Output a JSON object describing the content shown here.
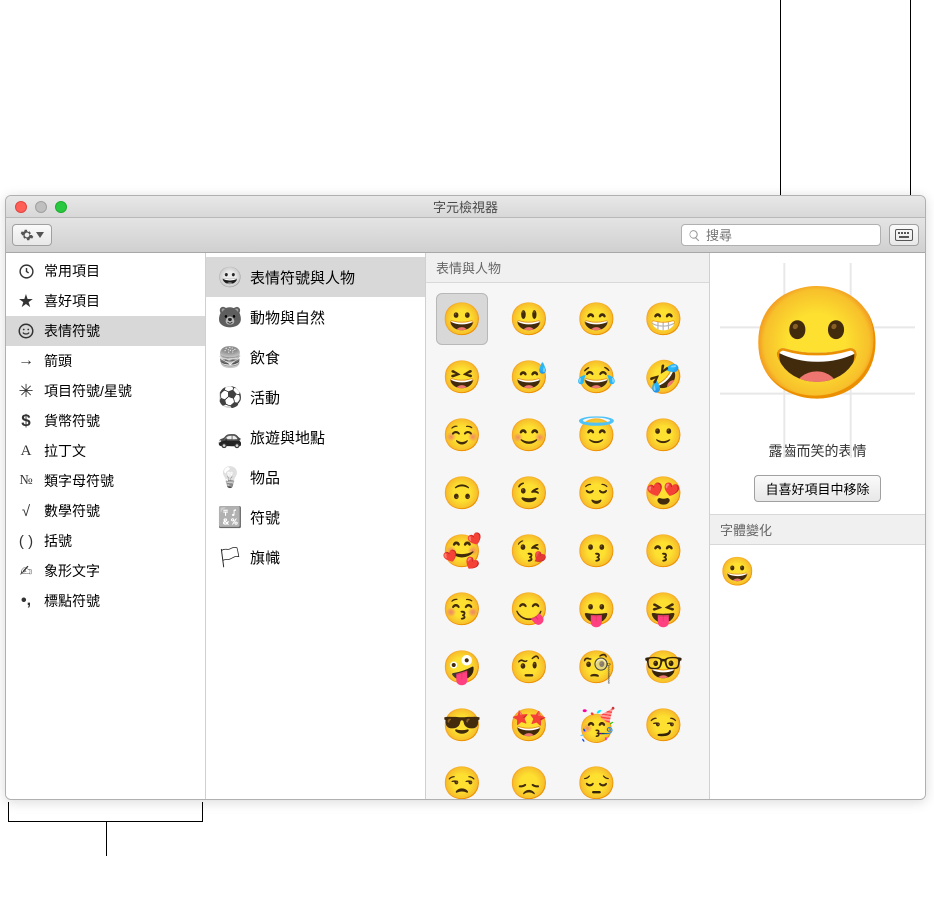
{
  "window": {
    "title": "字元檢視器",
    "search_placeholder": "搜尋"
  },
  "sidebar1": {
    "items": [
      {
        "icon": "clock",
        "label": "常用項目"
      },
      {
        "icon": "star",
        "label": "喜好項目"
      },
      {
        "icon": "smiley",
        "label": "表情符號",
        "selected": true
      },
      {
        "icon": "arrow",
        "label": "箭頭"
      },
      {
        "icon": "asterisk",
        "label": "項目符號/星號"
      },
      {
        "icon": "dollar",
        "label": "貨幣符號"
      },
      {
        "icon": "latin",
        "label": "拉丁文"
      },
      {
        "icon": "letterlike",
        "label": "類字母符號"
      },
      {
        "icon": "math",
        "label": "數學符號"
      },
      {
        "icon": "paren",
        "label": "括號"
      },
      {
        "icon": "picto",
        "label": "象形文字"
      },
      {
        "icon": "punct",
        "label": "標點符號"
      }
    ]
  },
  "sidebar2": {
    "items": [
      {
        "emoji": "😀",
        "label": "表情符號與人物",
        "selected": true
      },
      {
        "emoji": "🐻",
        "label": "動物與自然"
      },
      {
        "emoji": "🍔",
        "label": "飲食"
      },
      {
        "emoji": "⚽",
        "label": "活動"
      },
      {
        "emoji": "🚗",
        "label": "旅遊與地點"
      },
      {
        "emoji": "💡",
        "label": "物品"
      },
      {
        "emoji": "🔣",
        "label": "符號"
      },
      {
        "emoji": "🏳",
        "label": "旗幟"
      }
    ]
  },
  "grid": {
    "header": "表情與人物",
    "emojis": [
      "😀",
      "😃",
      "😄",
      "😁",
      "😆",
      "😅",
      "😂",
      "🤣",
      "☺️",
      "😊",
      "😇",
      "🙂",
      "🙃",
      "😉",
      "😌",
      "😍",
      "🥰",
      "😘",
      "😗",
      "😙",
      "😚",
      "😋",
      "😛",
      "😝",
      "🤪",
      "🤨",
      "🧐",
      "🤓",
      "😎",
      "🤩",
      "🥳",
      "😏",
      "😒",
      "😞",
      "😔"
    ],
    "selected_index": 0
  },
  "detail": {
    "preview": "😀",
    "name": "露齒而笑的表情",
    "remove_label": "自喜好項目中移除",
    "variation_header": "字體變化",
    "variation_emoji": "😀"
  }
}
